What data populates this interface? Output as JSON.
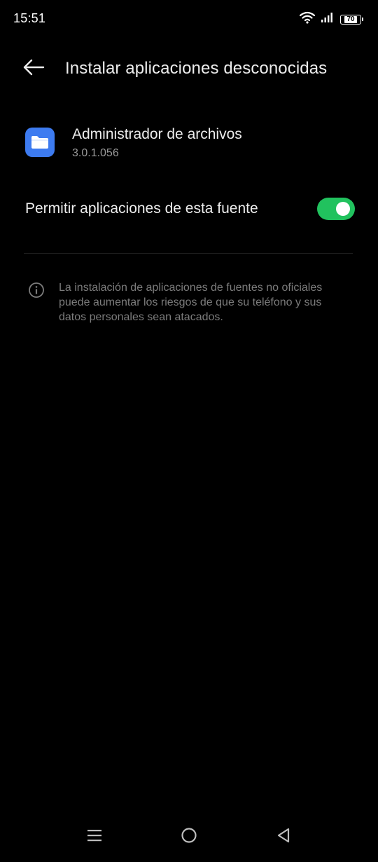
{
  "status_bar": {
    "time": "15:51",
    "battery_level": "70",
    "icons": [
      "wifi-icon",
      "signal-icon",
      "battery-icon"
    ]
  },
  "header": {
    "title": "Instalar aplicaciones desconocidas",
    "back_icon": "arrow-left-icon"
  },
  "app": {
    "name": "Administrador de archivos",
    "version": "3.0.1.056",
    "icon": "folder-icon",
    "icon_color": "#3d7bf0"
  },
  "setting": {
    "label": "Permitir aplicaciones de esta fuente",
    "enabled": true,
    "toggle_color": "#21c25e"
  },
  "info": {
    "icon": "info-icon",
    "text": "La instalación de aplicaciones de fuentes no oficiales puede aumentar los riesgos de que su teléfono y sus datos personales sean atacados."
  },
  "nav_bar": {
    "icons": [
      "menu-icon",
      "home-circle-icon",
      "back-triangle-icon"
    ]
  }
}
